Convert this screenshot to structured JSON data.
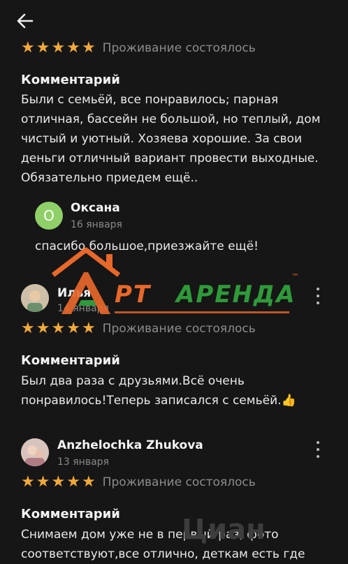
{
  "nav": {
    "back_icon": "arrow-left-icon"
  },
  "colors": {
    "star": "#f2a93b",
    "avatar_green": "#8fd068",
    "logo_orange": "#e8682a",
    "logo_green": "#2f9a3a"
  },
  "review1": {
    "rating": 5,
    "stay_status": "Проживание состоялось",
    "comment_heading": "Комментарий",
    "comment": "Были с семьёй, все понравилось; парная отличная, бассейн не большой, но теплый, дом чистый и уютный. Хозяева хорошие. За свои деньги отличный вариант провести выходные. Обязательно приедем ещё..",
    "reply": {
      "avatar_letter": "О",
      "author": "Оксана",
      "date": "16 января",
      "text": "спасибо большое,приезжайте ещё!"
    }
  },
  "review2": {
    "author": "Илья",
    "date": "14 января",
    "rating": 5,
    "stay_status": "Проживание состоялось",
    "comment_heading": "Комментарий",
    "comment": "Был два раза с друзьями.Всё очень понравилось!Теперь записался с семьёй.👍"
  },
  "review3": {
    "author": "Anzhelochka Zhukova",
    "date": "13 января",
    "rating": 5,
    "stay_status": "Проживание состоялось",
    "comment_heading": "Комментарий",
    "comment": "Снимаем дом уже не в первый раз, фото соответствуют,все отлично, деткам есть где"
  },
  "watermark": {
    "logo_left": "РТ",
    "logo_right": "АРЕНДА",
    "logo_letter": "А",
    "tm": "™",
    "corner": "Циан"
  }
}
